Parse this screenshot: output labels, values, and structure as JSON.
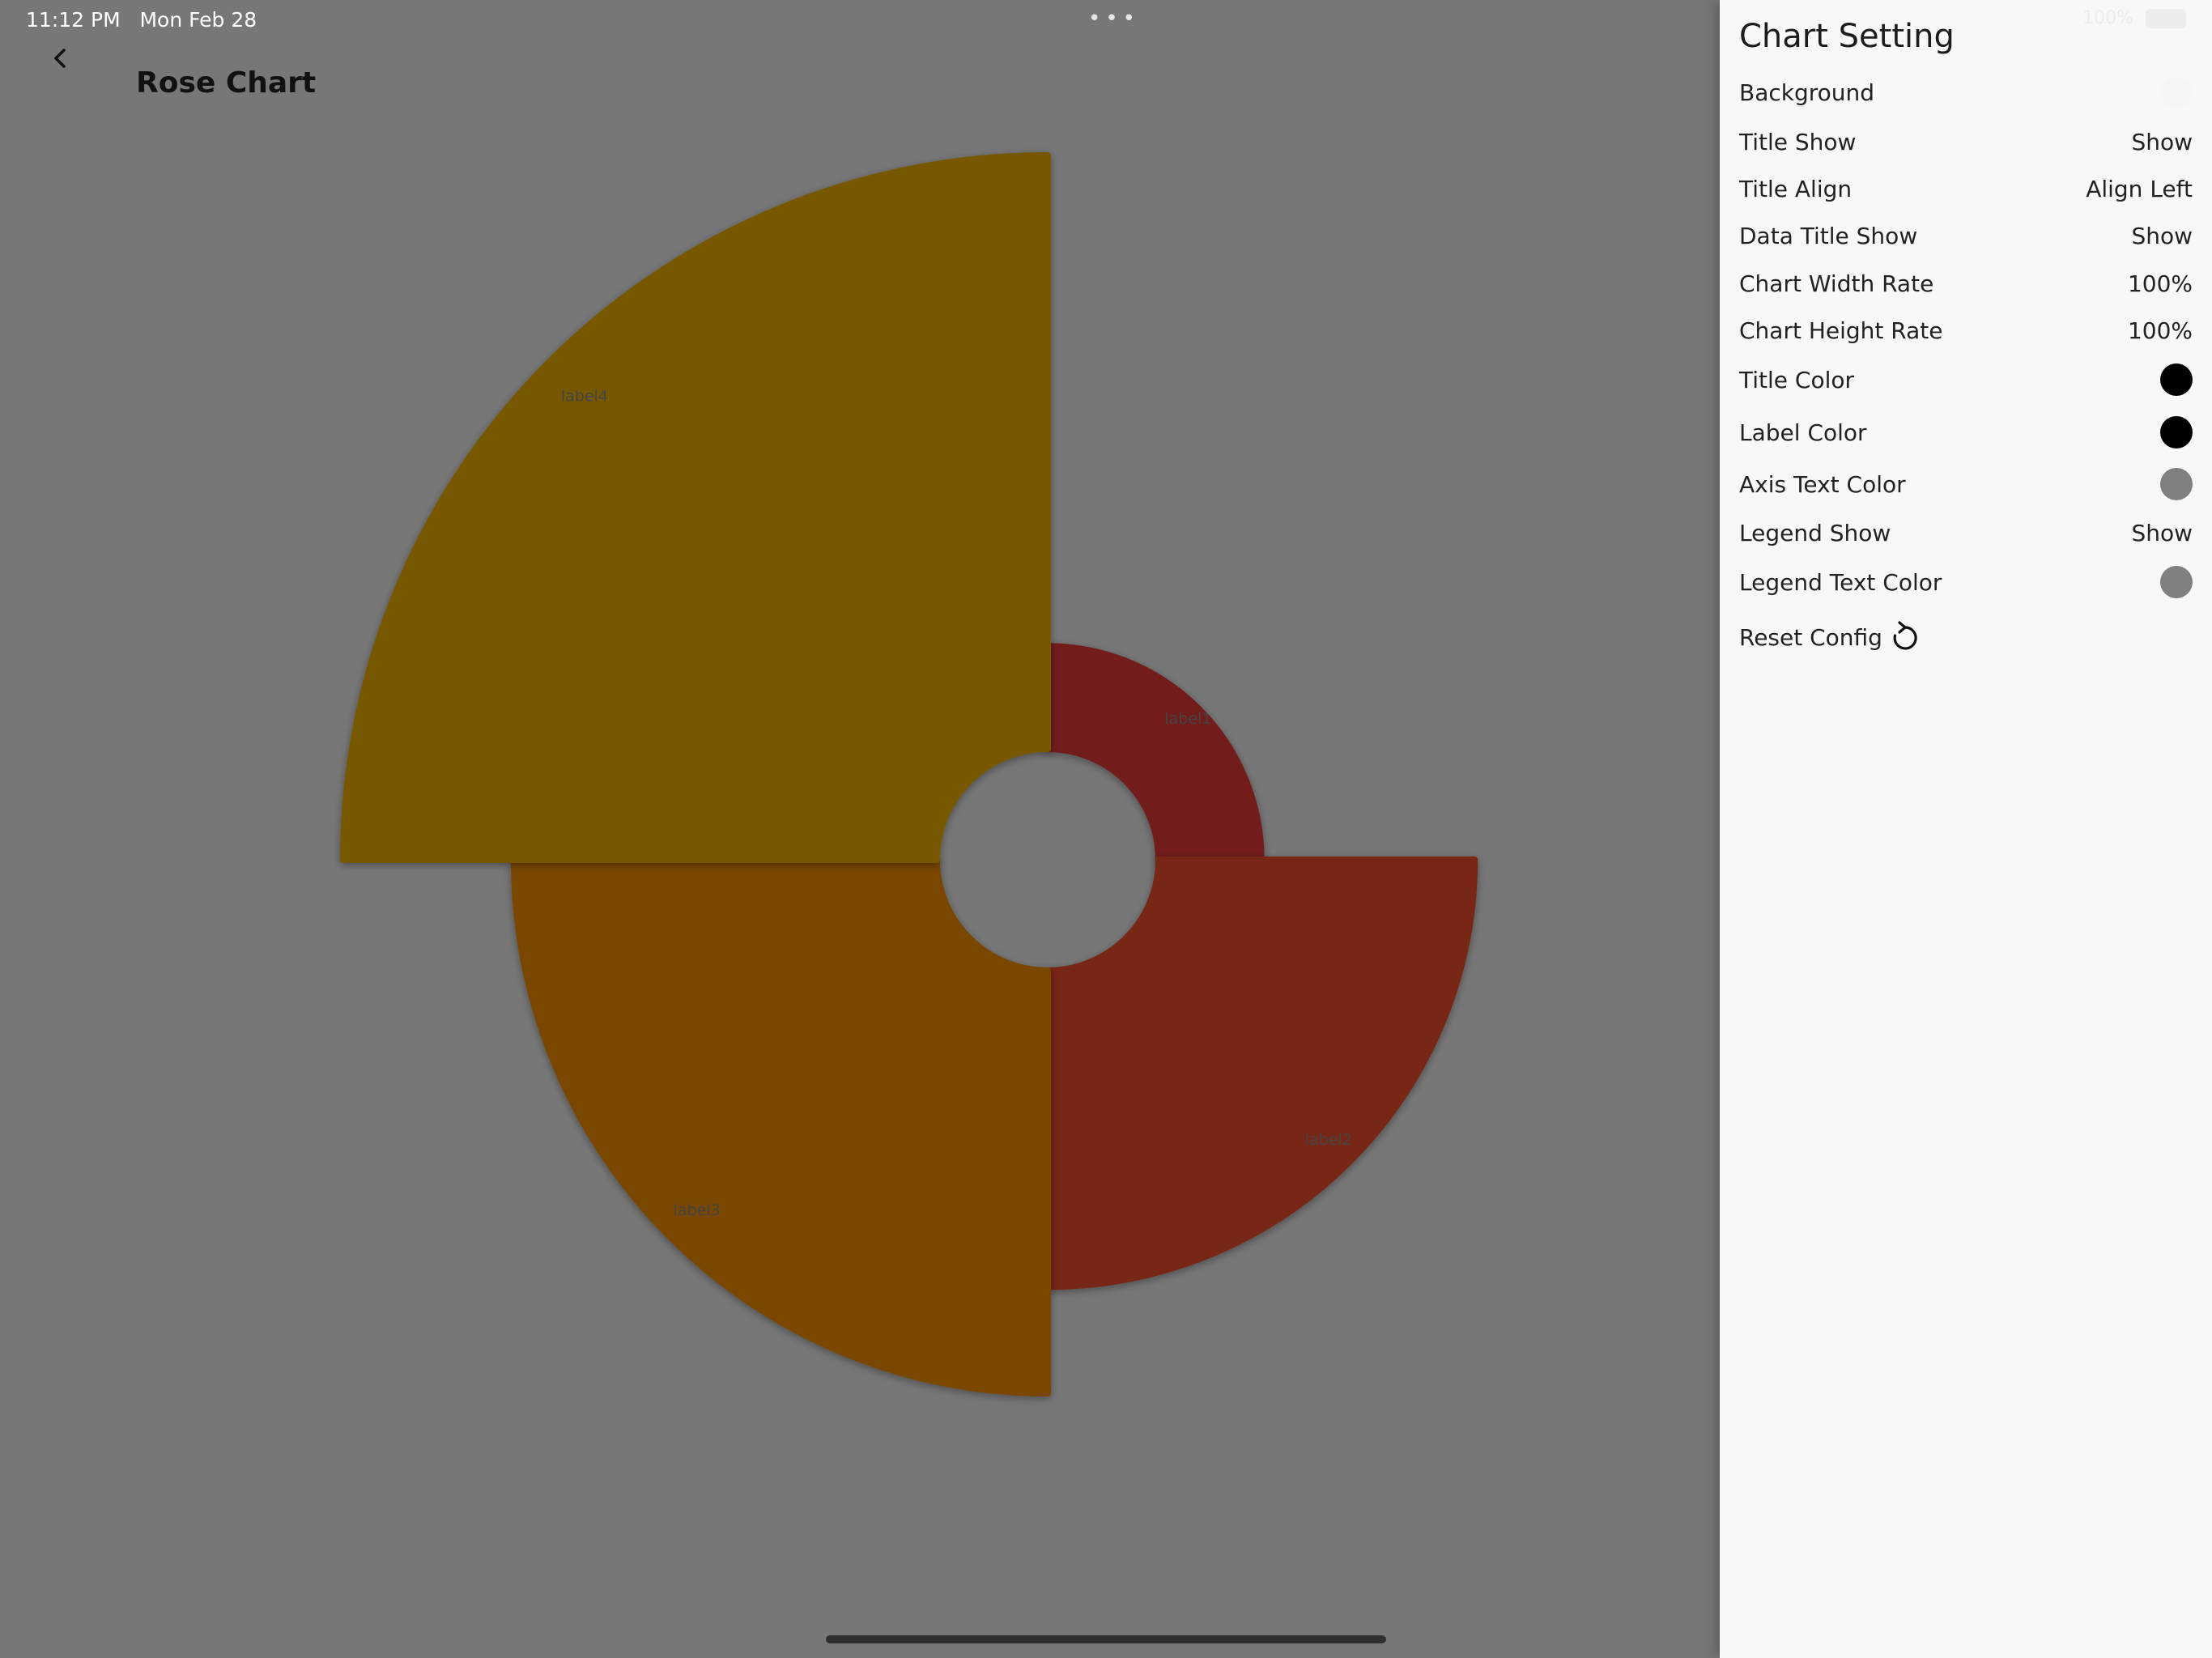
{
  "status_bar": {
    "time": "11:12 PM",
    "date": "Mon Feb 28",
    "battery": "100%"
  },
  "header": {
    "title": "Rose Chart",
    "back_icon": "chevron-left-icon"
  },
  "chart_data": {
    "type": "pie",
    "variant": "rose",
    "categories": [
      "label1",
      "label2",
      "label3",
      "label4"
    ],
    "values": [
      1,
      2,
      2.5,
      3.3
    ],
    "colors": [
      "#721f1b",
      "#782812",
      "#7a4700",
      "#775900"
    ],
    "inner_radius_ratio": 0.28,
    "legend": "none"
  },
  "settings": {
    "title": "Chart Setting",
    "rows": [
      {
        "label": "Background",
        "type": "color",
        "value": "#f6f6f6"
      },
      {
        "label": "Title Show",
        "type": "text",
        "value": "Show"
      },
      {
        "label": "Title Align",
        "type": "text",
        "value": "Align Left"
      },
      {
        "label": "Data Title Show",
        "type": "text",
        "value": "Show"
      },
      {
        "label": "Chart Width Rate",
        "type": "text",
        "value": "100%"
      },
      {
        "label": "Chart Height Rate",
        "type": "text",
        "value": "100%"
      },
      {
        "label": "Title Color",
        "type": "color",
        "value": "#000000"
      },
      {
        "label": "Label Color",
        "type": "color",
        "value": "#000000"
      },
      {
        "label": "Axis Text Color",
        "type": "color",
        "value": "#808080"
      },
      {
        "label": "Legend Show",
        "type": "text",
        "value": "Show"
      },
      {
        "label": "Legend Text Color",
        "type": "color",
        "value": "#808080"
      }
    ],
    "reset_label": "Reset Config",
    "reset_icon": "reset-icon"
  }
}
